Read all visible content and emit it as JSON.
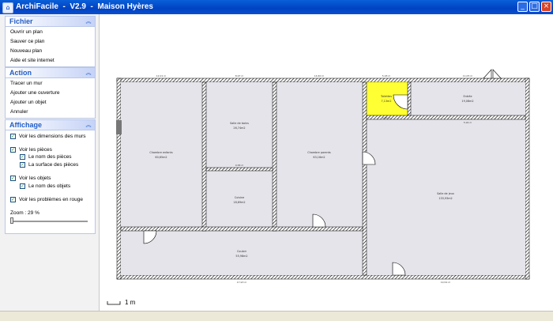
{
  "window": {
    "title": "ArchiFacile  -  V2.9  -  Maison Hyères",
    "min_label": "_",
    "max_label": "□",
    "close_label": "×"
  },
  "fichier": {
    "title": "Fichier",
    "items": [
      "Ouvrir un plan",
      "Sauver ce plan",
      "Nouveau plan",
      "Aide et site internet"
    ]
  },
  "action": {
    "title": "Action",
    "items": [
      "Tracer un mur",
      "Ajouter une ouverture",
      "Ajouter un objet",
      "Annuler"
    ]
  },
  "affichage": {
    "title": "Affichage",
    "options": [
      {
        "label": "Voir les dimensions des murs",
        "checked": true
      },
      {
        "label": "Voir les pièces",
        "checked": true
      },
      {
        "label": "Le nom des pièces",
        "checked": true
      },
      {
        "label": "La surface des pièces",
        "checked": true
      },
      {
        "label": "Voir les objets",
        "checked": true
      },
      {
        "label": "Le nom des objets",
        "checked": true
      },
      {
        "label": "Voir les problèmes en rouge",
        "checked": true
      }
    ],
    "zoom_label": "Zoom : 29 %",
    "zoom_value": 29
  },
  "plan": {
    "scale_label": "1 m",
    "rooms": [
      {
        "name": "Chambre enfants",
        "area": "60,65m2"
      },
      {
        "name": "Salle de bains",
        "area": "26,74m2"
      },
      {
        "name": "Cuisine",
        "area": "18,69m2"
      },
      {
        "name": "Chambre parents",
        "area": "63,16m2"
      },
      {
        "name": "Toilettes",
        "area": "7,13m2"
      },
      {
        "name": "Entrée",
        "area": "19,08m2"
      },
      {
        "name": "Salle de jeux",
        "area": "133,93m2"
      },
      {
        "name": "Couloir",
        "area": "55,98m2"
      }
    ],
    "dims": [
      "12,01 m",
      "8,97 m",
      "14,60 m",
      "5,18 m",
      "11,05 m",
      "9,58 m",
      "5,94 m",
      "4,50 m",
      "17,93 m",
      "19,54 m"
    ]
  }
}
